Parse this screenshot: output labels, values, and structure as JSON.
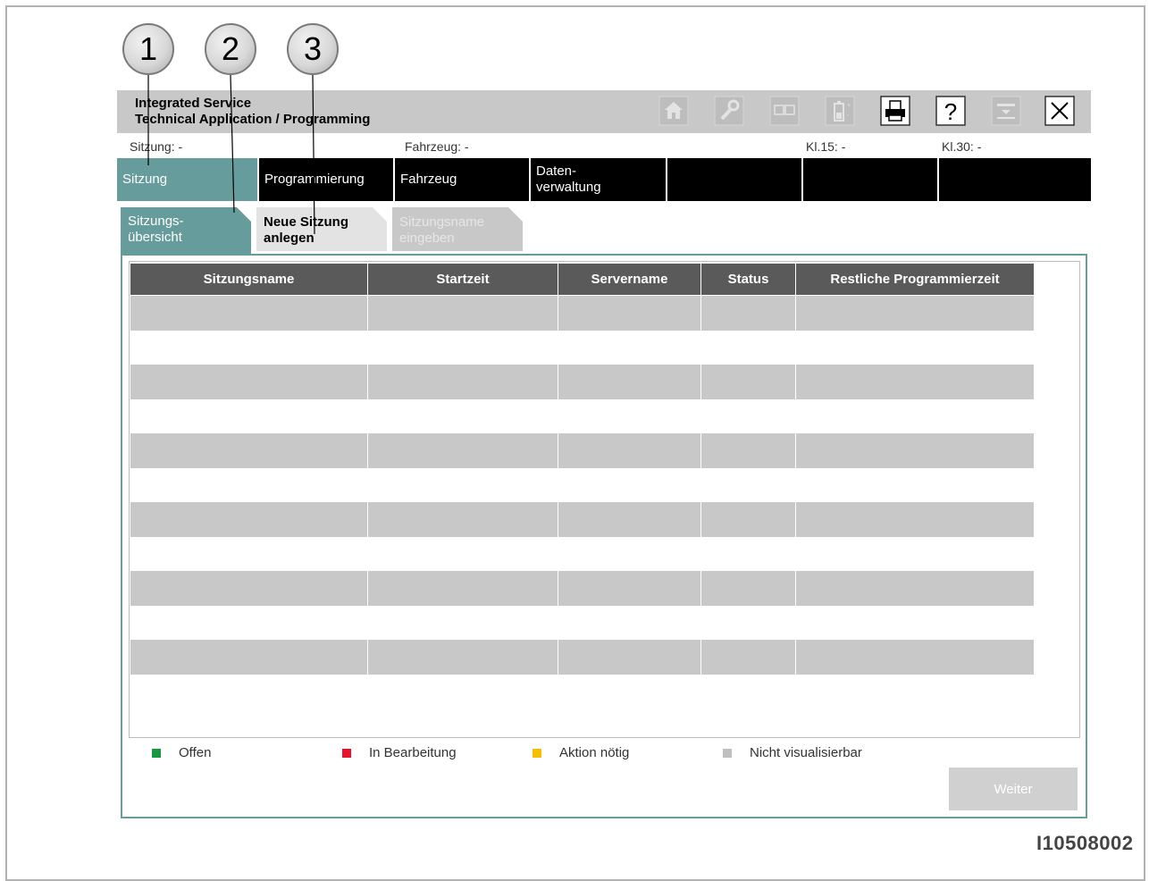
{
  "callouts": [
    "1",
    "2",
    "3"
  ],
  "header": {
    "title_line1": "Integrated Service",
    "title_line2": "Technical Application / Programming",
    "icons": [
      "home-icon",
      "wrench-icon",
      "dual-display-icon",
      "battery-icon",
      "printer-icon",
      "help-icon",
      "minimize-icon",
      "close-icon"
    ]
  },
  "info": {
    "session": "Sitzung: -",
    "vehicle": "Fahrzeug: -",
    "kl15": "Kl.15: -",
    "kl30": "Kl.30: -"
  },
  "nav": {
    "tabs": [
      "Sitzung",
      "Programmierung",
      "Fahrzeug",
      "Daten-\nverwaltung",
      "",
      "",
      ""
    ]
  },
  "subtabs": {
    "overview": "Sitzungs-\nübersicht",
    "new_session": "Neue Sitzung\nanlegen",
    "enter_name": "Sitzungsname\neingeben"
  },
  "table": {
    "headers": [
      "Sitzungsname",
      "Startzeit",
      "Servername",
      "Status",
      "Restliche Programmierzeit"
    ],
    "rows": [
      [
        "",
        "",
        "",
        "",
        ""
      ],
      [
        "",
        "",
        "",
        "",
        ""
      ],
      [
        "",
        "",
        "",
        "",
        ""
      ],
      [
        "",
        "",
        "",
        "",
        ""
      ],
      [
        "",
        "",
        "",
        "",
        ""
      ],
      [
        "",
        "",
        "",
        "",
        ""
      ]
    ]
  },
  "legend": [
    {
      "label": "Offen",
      "color": "#1a9641"
    },
    {
      "label": "In Bearbeitung",
      "color": "#e8102a"
    },
    {
      "label": "Aktion nötig",
      "color": "#f5c000"
    },
    {
      "label": "Nicht visualisierbar",
      "color": "#c0c0c0"
    }
  ],
  "buttons": {
    "next": "Weiter"
  },
  "image_id": "I10508002",
  "colors": {
    "accent": "#669c9c",
    "nav_bg": "#000000",
    "header_bg": "#c8c8c8",
    "table_header": "#5a5a5a"
  }
}
